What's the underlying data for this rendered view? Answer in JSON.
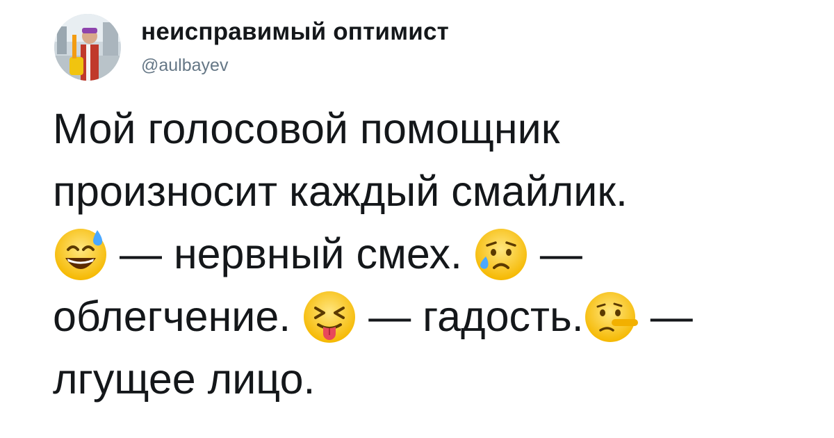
{
  "tweet": {
    "author": {
      "display_name": "неисправимый оптимист",
      "handle": "@aulbayev"
    },
    "lines": [
      [
        "Мой голосовой помощник"
      ],
      [
        "произносит каждый смайлик."
      ],
      [
        "— нервный смех.",
        "—"
      ],
      [
        "облегчение.",
        "— гадость.",
        "—"
      ],
      [
        "лгущее лицо."
      ]
    ],
    "emojis": [
      "grinning-face-with-sweat-icon",
      "sad-but-relieved-face-icon",
      "squinting-face-with-tongue-icon",
      "lying-face-icon"
    ]
  }
}
